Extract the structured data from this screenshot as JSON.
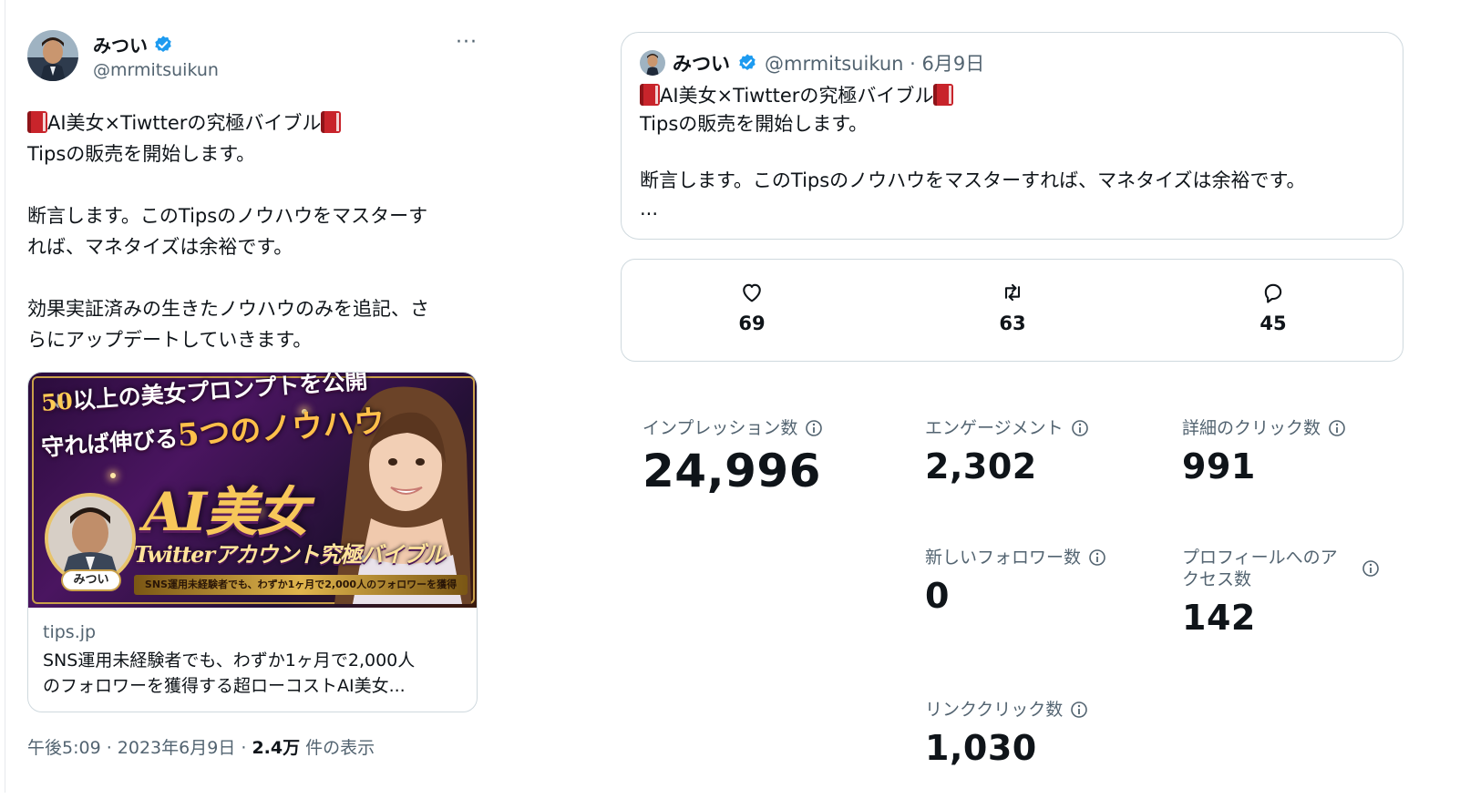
{
  "tweet": {
    "display_name": "みつい",
    "handle": "@mrmitsuikun",
    "more_label": "···",
    "lines": [
      "AI美女×Tiwtterの究極バイブル",
      "Tipsの販売を開始します。",
      "断言します。このTipsのノウハウをマスターす",
      "れば、マネタイズは余裕です。",
      "効果実証済みの生きたノウハウのみを追記、さ",
      "らにアップデートしていきます。"
    ],
    "card": {
      "promo_line1_pre": "50",
      "promo_line1_post": "以上の美女プロンプトを公開",
      "promo_line2_pre": "守れば伸びる",
      "promo_line2_big": "5つのノウハウ",
      "promo_title": "AI美女",
      "promo_subtitle": "Twitterアカウント究極バイブル",
      "promo_strip": "SNS運用未経験者でも、わずか1ヶ月で2,000人のフォロワーを獲得",
      "promo_name": "みつい",
      "domain": "tips.jp",
      "desc_line1": "SNS運用未経験者でも、わずか1ヶ月で2,000人",
      "desc_line2": "のフォロワーを獲得する超ローコストAI美女..."
    },
    "time": "午後5:09 · 2023年6月9日 · ",
    "views_count": "2.4万",
    "views_label": " 件の表示"
  },
  "quote": {
    "display_name": "みつい",
    "handle_date": "@mrmitsuikun · 6月9日",
    "line1": "AI美女×Tiwtterの究極バイブル",
    "line2": "Tipsの販売を開始します。",
    "line3": "断言します。このTipsのノウハウをマスターすれば、マネタイズは余裕です。",
    "line4": "..."
  },
  "counts": {
    "likes": "69",
    "retweets": "63",
    "replies": "45"
  },
  "metrics": {
    "impressions": {
      "label": "インプレッション数",
      "value": "24,996"
    },
    "engagements": {
      "label": "エンゲージメント",
      "value": "2,302"
    },
    "detail_clicks": {
      "label": "詳細のクリック数",
      "value": "991"
    },
    "new_followers": {
      "label": "新しいフォロワー数",
      "value": "0"
    },
    "profile_visits": {
      "label_line1": "プロフィールへのア",
      "label_line2": "クセス数",
      "value": "142"
    },
    "link_clicks": {
      "label": "リンククリック数",
      "value": "1,030"
    }
  },
  "colors": {
    "verified": "#1d9bf0",
    "muted": "#536471",
    "border": "#cfd9de"
  }
}
